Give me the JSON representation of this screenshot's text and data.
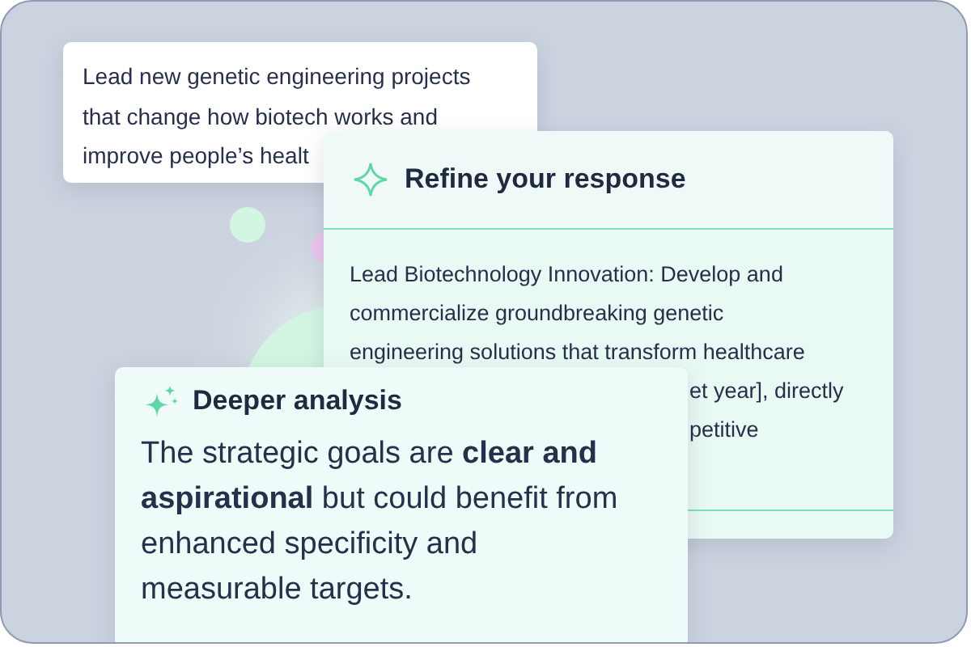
{
  "prompt_card": {
    "lines": [
      "Lead new genetic engineering projects",
      "that change how biotech works and",
      "improve people’s healt"
    ]
  },
  "refine_card": {
    "title": "Refine your response",
    "lines": [
      {
        "kind": "full",
        "text": "Lead Biotechnology Innovation: Develop and"
      },
      {
        "kind": "full",
        "text": "commercialize groundbreaking genetic"
      },
      {
        "kind": "full",
        "text": "engineering solutions that transform healthcare"
      },
      {
        "kind": "partial",
        "text": "et year], directly"
      },
      {
        "kind": "partial",
        "text": "petitive"
      }
    ]
  },
  "analysis_card": {
    "title": "Deeper analysis",
    "text": "The strategic goals are **clear and aspirational** but could benefit from enhanced specificity and measurable targets."
  }
}
